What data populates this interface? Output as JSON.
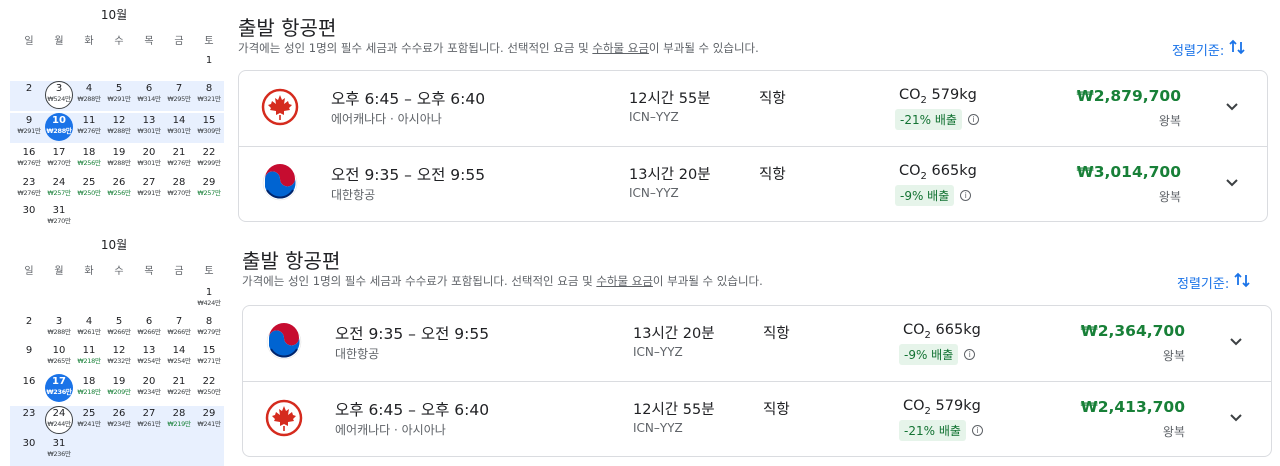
{
  "calendar": {
    "weekdays": [
      "일",
      "월",
      "화",
      "수",
      "목",
      "금",
      "토"
    ],
    "months": [
      {
        "title": "10월",
        "days": [
          {
            "d": "1",
            "p": ""
          },
          {
            "d": "2",
            "p": ""
          },
          {
            "d": "3",
            "p": "₩524만",
            "ring": true
          },
          {
            "d": "4",
            "p": "₩288만"
          },
          {
            "d": "5",
            "p": "₩291만"
          },
          {
            "d": "6",
            "p": "₩314만"
          },
          {
            "d": "7",
            "p": "₩295만"
          },
          {
            "d": "8",
            "p": "₩321만"
          },
          {
            "d": "9",
            "p": "₩291만"
          },
          {
            "d": "10",
            "p": "₩288만",
            "sel": true
          },
          {
            "d": "11",
            "p": "₩276만"
          },
          {
            "d": "12",
            "p": "₩288만"
          },
          {
            "d": "13",
            "p": "₩301만"
          },
          {
            "d": "14",
            "p": "₩301만"
          },
          {
            "d": "15",
            "p": "₩309만"
          },
          {
            "d": "16",
            "p": "₩276만"
          },
          {
            "d": "17",
            "p": "₩270만"
          },
          {
            "d": "18",
            "p": "₩256만",
            "low": true
          },
          {
            "d": "19",
            "p": "₩288만"
          },
          {
            "d": "20",
            "p": "₩301만"
          },
          {
            "d": "21",
            "p": "₩276만"
          },
          {
            "d": "22",
            "p": "₩299만"
          },
          {
            "d": "23",
            "p": "₩276만"
          },
          {
            "d": "24",
            "p": "₩257만",
            "low": true
          },
          {
            "d": "25",
            "p": "₩250만",
            "low": true
          },
          {
            "d": "26",
            "p": "₩256만",
            "low": true
          },
          {
            "d": "27",
            "p": "₩291만"
          },
          {
            "d": "28",
            "p": "₩270만"
          },
          {
            "d": "29",
            "p": "₩257만",
            "low": true
          },
          {
            "d": "30",
            "p": ""
          },
          {
            "d": "31",
            "p": "₩270만"
          }
        ]
      },
      {
        "title": "10월",
        "days": [
          {
            "d": "1",
            "p": "₩424만"
          },
          {
            "d": "2",
            "p": ""
          },
          {
            "d": "3",
            "p": "₩288만"
          },
          {
            "d": "4",
            "p": "₩261만"
          },
          {
            "d": "5",
            "p": "₩266만"
          },
          {
            "d": "6",
            "p": "₩266만"
          },
          {
            "d": "7",
            "p": "₩266만"
          },
          {
            "d": "8",
            "p": "₩279만"
          },
          {
            "d": "9",
            "p": ""
          },
          {
            "d": "10",
            "p": "₩265만"
          },
          {
            "d": "11",
            "p": "₩218만",
            "low": true
          },
          {
            "d": "12",
            "p": "₩232만"
          },
          {
            "d": "13",
            "p": "₩254만"
          },
          {
            "d": "14",
            "p": "₩254만"
          },
          {
            "d": "15",
            "p": "₩271만"
          },
          {
            "d": "16",
            "p": ""
          },
          {
            "d": "17",
            "p": "₩236만",
            "sel": true
          },
          {
            "d": "18",
            "p": "₩218만",
            "low": true
          },
          {
            "d": "19",
            "p": "₩209만",
            "low": true
          },
          {
            "d": "20",
            "p": "₩234만"
          },
          {
            "d": "21",
            "p": "₩226만"
          },
          {
            "d": "22",
            "p": "₩250만"
          },
          {
            "d": "23",
            "p": ""
          },
          {
            "d": "24",
            "p": "₩244만",
            "ring": true
          },
          {
            "d": "25",
            "p": "₩241만"
          },
          {
            "d": "26",
            "p": "₩234만"
          },
          {
            "d": "27",
            "p": "₩261만"
          },
          {
            "d": "28",
            "p": "₩219만",
            "low": true
          },
          {
            "d": "29",
            "p": "₩241만"
          },
          {
            "d": "30",
            "p": ""
          },
          {
            "d": "31",
            "p": "₩236만"
          }
        ]
      }
    ]
  },
  "sections": [
    {
      "title": "출발 항공편",
      "sub_pre": "가격에는 성인 1명의 필수 세금과 수수료가 포함됩니다. 선택적인 요금 및 ",
      "sub_link": "수하물 요금",
      "sub_post": "이 부과될 수 있습니다.",
      "sort_label": "정렬기준:",
      "flights": [
        {
          "logo": "air-canada",
          "times": "오후 6:45 – 오후 6:40",
          "airline": "에어캐나다 · 아시아나",
          "duration": "12시간 55분",
          "route": "ICN–YYZ",
          "stops": "직항",
          "co2": "579kg",
          "emissions": "-21% 배출",
          "price": "₩2,879,700",
          "trip": "왕복"
        },
        {
          "logo": "korean-air",
          "times": "오전 9:35 – 오전 9:55",
          "airline": "대한항공",
          "duration": "13시간 20분",
          "route": "ICN–YYZ",
          "stops": "직항",
          "co2": "665kg",
          "emissions": "-9% 배출",
          "price": "₩3,014,700",
          "trip": "왕복"
        }
      ]
    },
    {
      "title": "출발 항공편",
      "sub_pre": "가격에는 성인 1명의 필수 세금과 수수료가 포함됩니다. 선택적인 요금 및 ",
      "sub_link": "수하물 요금",
      "sub_post": "이 부과될 수 있습니다.",
      "sort_label": "정렬기준:",
      "flights": [
        {
          "logo": "korean-air",
          "times": "오전 9:35 – 오전 9:55",
          "airline": "대한항공",
          "duration": "13시간 20분",
          "route": "ICN–YYZ",
          "stops": "직항",
          "co2": "665kg",
          "emissions": "-9% 배출",
          "price": "₩2,364,700",
          "trip": "왕복"
        },
        {
          "logo": "air-canada",
          "times": "오후 6:45 – 오후 6:40",
          "airline": "에어캐나다 · 아시아나",
          "duration": "12시간 55분",
          "route": "ICN–YYZ",
          "stops": "직항",
          "co2": "579kg",
          "emissions": "-21% 배출",
          "price": "₩2,413,700",
          "trip": "왕복"
        }
      ]
    }
  ],
  "co2_label": "CO",
  "co2_sub": "2",
  "colors": {
    "accent": "#1a73e8",
    "price": "#188038",
    "highlight": "#e8f0fe",
    "badge": "#e6f4ea"
  }
}
